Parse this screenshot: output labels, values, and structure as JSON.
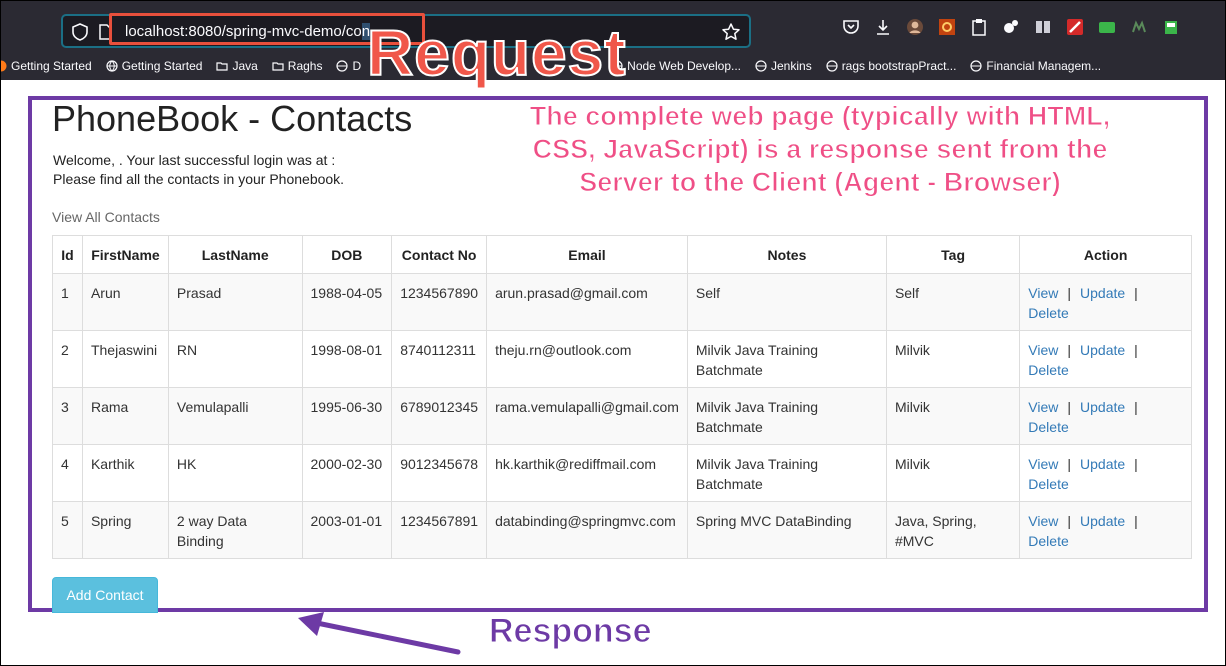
{
  "browser": {
    "url_prefix": "localhost:8080/spring-mvc-demo/co",
    "url_selected": "n",
    "bookmarks": [
      {
        "label": "Getting Started",
        "icon": "firefox-icon"
      },
      {
        "label": "Getting Started",
        "icon": "globe-icon"
      },
      {
        "label": "Java",
        "icon": "folder-icon"
      },
      {
        "label": "Raghs",
        "icon": "folder-icon"
      },
      {
        "label": "D",
        "icon": "globe-icon"
      },
      {
        "label": "Node Web Develop...",
        "icon": "globe-icon"
      },
      {
        "label": "Jenkins",
        "icon": "globe-icon"
      },
      {
        "label": "rags bootstrapPract...",
        "icon": "globe-icon"
      },
      {
        "label": "Financial Managem...",
        "icon": "globe-icon"
      }
    ]
  },
  "page": {
    "title": "PhoneBook - Contacts",
    "welcome_line1": "Welcome, . Your last successful login was at :",
    "welcome_line2": "Please find all the contacts in your Phonebook.",
    "view_all": "View All Contacts",
    "add_button": "Add Contact"
  },
  "table": {
    "headers": [
      "Id",
      "FirstName",
      "LastName",
      "DOB",
      "Contact No",
      "Email",
      "Notes",
      "Tag",
      "Action"
    ],
    "action_labels": {
      "view": "View",
      "update": "Update",
      "delete": "Delete",
      "separator": "|"
    },
    "rows": [
      {
        "id": "1",
        "first": "Arun",
        "last": "Prasad",
        "dob": "1988-04-05",
        "phone": "1234567890",
        "email": "arun.prasad@gmail.com",
        "notes": "Self",
        "tag": "Self"
      },
      {
        "id": "2",
        "first": "Thejaswini",
        "last": "RN",
        "dob": "1998-08-01",
        "phone": "8740112311",
        "email": "theju.rn@outlook.com",
        "notes": "Milvik Java Training Batchmate",
        "tag": "Milvik"
      },
      {
        "id": "3",
        "first": "Rama",
        "last": "Vemulapalli",
        "dob": "1995-06-30",
        "phone": "6789012345",
        "email": "rama.vemulapalli@gmail.com",
        "notes": "Milvik Java Training Batchmate",
        "tag": "Milvik"
      },
      {
        "id": "4",
        "first": "Karthik",
        "last": "HK",
        "dob": "2000-02-30",
        "phone": "9012345678",
        "email": "hk.karthik@rediffmail.com",
        "notes": "Milvik Java Training Batchmate",
        "tag": "Milvik"
      },
      {
        "id": "5",
        "first": "Spring",
        "last": "2 way Data Binding",
        "dob": "2003-01-01",
        "phone": "1234567891",
        "email": "databinding@springmvc.com",
        "notes": "Spring MVC DataBinding",
        "tag": "Java, Spring, #MVC"
      }
    ]
  },
  "annotations": {
    "request": "Request",
    "response": "Response",
    "response_note": "The complete web page (typically with HTML, CSS, JavaScript) is a response sent from the Server to the Client (Agent  - Browser)",
    "request_color": "#f0574a",
    "response_color": "#6d3aa5",
    "note_color": "#ef4f86"
  }
}
